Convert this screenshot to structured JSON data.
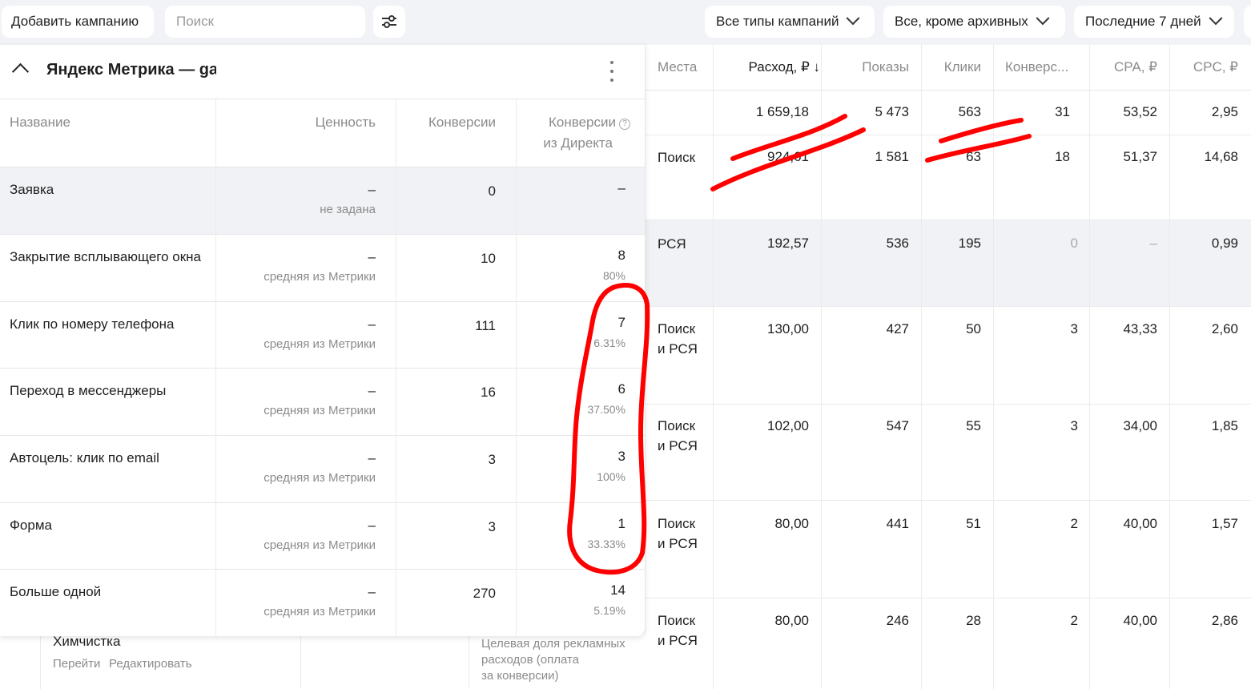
{
  "toolbar": {
    "add_campaign": "Добавить кампанию",
    "search_placeholder": "Поиск",
    "campaign_types": "Все типы кампаний",
    "status_filter": "Все, кроме архивных",
    "period": "Последние 7 дней"
  },
  "stats_table": {
    "headers": {
      "places": "Места",
      "spend": "Расход, ₽ ↓",
      "impressions": "Показы",
      "clicks": "Клики",
      "conversions": "Конверс...",
      "cpa": "CPA, ₽",
      "cpc": "CPC, ₽"
    },
    "rows": [
      {
        "place": "",
        "spend": "1 659,18",
        "impressions": "5 473",
        "clicks": "563",
        "conversions": "31",
        "cpa": "53,52",
        "cpc": "2,95"
      },
      {
        "place": "Поиск",
        "spend": "924,61",
        "impressions": "1 581",
        "clicks": "63",
        "conversions": "18",
        "cpa": "51,37",
        "cpc": "14,68"
      },
      {
        "place": "РСЯ",
        "spend": "192,57",
        "impressions": "536",
        "clicks": "195",
        "conversions": "0",
        "cpa": "–",
        "cpc": "0,99"
      },
      {
        "place": "Поиск и РСЯ",
        "place_line1": "Поиск",
        "place_line2": "и РСЯ",
        "spend": "130,00",
        "impressions": "427",
        "clicks": "50",
        "conversions": "3",
        "cpa": "43,33",
        "cpc": "2,60"
      },
      {
        "place_line1": "Поиск",
        "place_line2": "и РСЯ",
        "spend": "102,00",
        "impressions": "547",
        "clicks": "55",
        "conversions": "3",
        "cpa": "34,00",
        "cpc": "1,85"
      },
      {
        "place_line1": "Поиск",
        "place_line2": "и РСЯ",
        "spend": "80,00",
        "impressions": "441",
        "clicks": "51",
        "conversions": "2",
        "cpa": "40,00",
        "cpc": "1,57"
      },
      {
        "place_line1": "Поиск",
        "place_line2": "и РСЯ",
        "spend": "80,00",
        "impressions": "246",
        "clicks": "28",
        "conversions": "2",
        "cpa": "40,00",
        "cpc": "2,86"
      }
    ]
  },
  "background_campaign": {
    "name": "Химчистка",
    "link_go": "Перейти",
    "link_edit": "Редактировать",
    "strategy_line1": "Целевая доля рекламных",
    "strategy_line2": "расходов (оплата",
    "strategy_line3": "за конверсии)"
  },
  "goals_panel": {
    "title": "Яндекс Метрика — gar",
    "headers": {
      "name": "Название",
      "value": "Ценность",
      "conversions": "Конверсии",
      "direct_line1": "Конверсии",
      "direct_line2": "из Директа"
    },
    "rows": [
      {
        "name": "Заявка",
        "value": "–",
        "value_note": "не задана",
        "conversions": "0",
        "direct": "–",
        "direct_pct": ""
      },
      {
        "name": "Закрытие всплывающего окна",
        "value": "–",
        "value_note": "средняя из Метрики",
        "conversions": "10",
        "direct": "8",
        "direct_pct": "80%"
      },
      {
        "name": "Клик по номеру телефона",
        "value": "–",
        "value_note": "средняя из Метрики",
        "conversions": "111",
        "direct": "7",
        "direct_pct": "6.31%"
      },
      {
        "name": "Переход в мессенджеры",
        "value": "–",
        "value_note": "средняя из Метрики",
        "conversions": "16",
        "direct": "6",
        "direct_pct": "37.50%"
      },
      {
        "name": "Автоцель: клик по email",
        "value": "–",
        "value_note": "средняя из Метрики",
        "conversions": "3",
        "direct": "3",
        "direct_pct": "100%"
      },
      {
        "name": "Форма",
        "value": "–",
        "value_note": "средняя из Метрики",
        "conversions": "3",
        "direct": "1",
        "direct_pct": "33.33%"
      },
      {
        "name": "Больше одной",
        "value": "–",
        "value_note": "средняя из Метрики",
        "conversions": "270",
        "direct": "14",
        "direct_pct": "5.19%"
      }
    ]
  },
  "annotation_color": "#ff0000"
}
